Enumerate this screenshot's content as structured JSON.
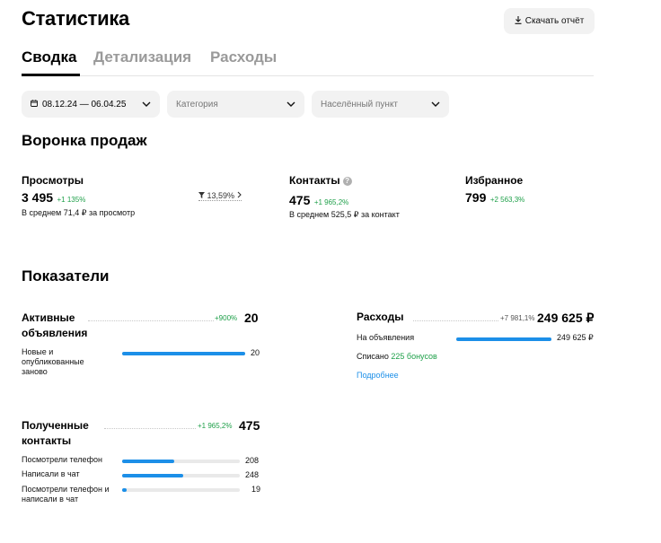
{
  "header": {
    "title": "Статистика",
    "download_label": "Скачать отчёт"
  },
  "tabs": [
    {
      "label": "Сводка",
      "active": true
    },
    {
      "label": "Детализация",
      "active": false
    },
    {
      "label": "Расходы",
      "active": false
    }
  ],
  "filters": {
    "date_range": "08.12.24 — 06.04.25",
    "category_placeholder": "Категория",
    "city_placeholder": "Населённый пункт"
  },
  "funnel": {
    "title": "Воронка продаж",
    "views": {
      "label": "Просмотры",
      "value": "3 495",
      "delta": "+1 135%",
      "note": "В среднем 71,4 ₽ за просмотр"
    },
    "conversion": "13,59%",
    "contacts": {
      "label": "Контакты",
      "value": "475",
      "delta": "+1 965,2%",
      "note": "В среднем 525,5 ₽ за контакт"
    },
    "favorites": {
      "label": "Избранное",
      "value": "799",
      "delta": "+2 563,3%"
    }
  },
  "indicators": {
    "title": "Показатели",
    "active_ads": {
      "label": "Активные объявления",
      "delta": "+900%",
      "value": "20",
      "rows": [
        {
          "label": "Новые и опубликованные заново",
          "value": "20",
          "fraction": 1.0
        }
      ]
    },
    "received_contacts": {
      "label": "Полученные контакты",
      "delta": "+1 965,2%",
      "value": "475",
      "rows": [
        {
          "label": "Посмотрели телефон",
          "value": "208",
          "fraction": 0.44
        },
        {
          "label": "Написали в чат",
          "value": "248",
          "fraction": 0.52
        },
        {
          "label": "Посмотрели телефон и написали в чат",
          "value": "19",
          "fraction": 0.04
        }
      ]
    },
    "expenses": {
      "label": "Расходы",
      "delta": "+7 981,1%",
      "value": "249 625 ₽",
      "rows": [
        {
          "label": "На объявления",
          "value": "249 625 ₽",
          "fraction": 1.0
        }
      ],
      "bonus_prefix": "Списано",
      "bonus_value": "225 бонусов",
      "more_link": "Подробнее"
    }
  },
  "colors": {
    "accent": "#1c8fe8",
    "positive": "#1fa04a"
  }
}
